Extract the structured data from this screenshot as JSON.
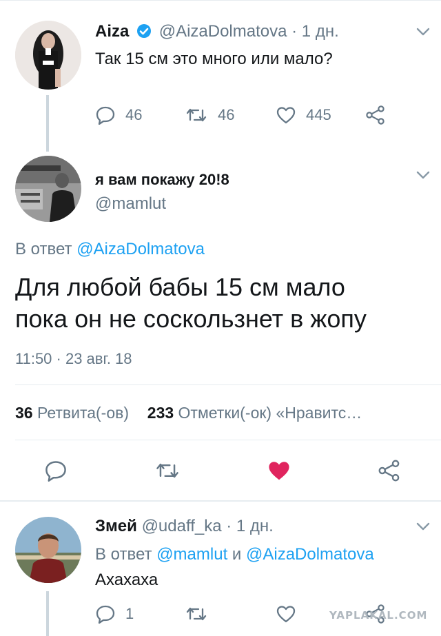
{
  "tweet1": {
    "name": "Aiza",
    "handle": "@AizaDolmatova",
    "time": "· 1 дн.",
    "text": "Так 15 см это много или мало?",
    "reply_count": "46",
    "retweet_count": "46",
    "like_count": "445"
  },
  "tweet2": {
    "name": "я вам покажу 20!8",
    "handle": "@mamlut",
    "reply_prefix": "В ответ",
    "reply_to": "@AizaDolmatova",
    "text_line1": "Для любой бабы 15 см мало",
    "text_line2": "пока он не соскользнет в жопу",
    "timestamp": "11:50 · 23 авг. 18",
    "retweets_num": "36",
    "retweets_label": "Ретвита(-ов)",
    "likes_num": "233",
    "likes_label": "Отметки(-ок) «Нравитс…"
  },
  "tweet3": {
    "name": "Змей",
    "handle": "@udaff_ka",
    "time": "· 1 дн.",
    "reply_prefix": "В ответ",
    "reply_to_1": "@mamlut",
    "reply_and": "и",
    "reply_to_2": "@AizaDolmatova",
    "text": "Ахахаха",
    "reply_count": "1"
  },
  "colors": {
    "accent": "#1da1f2",
    "like_active": "#e0245e",
    "muted": "#657786",
    "verified": "#1da1f2"
  },
  "icons": [
    "chevron-down-icon",
    "verified-icon",
    "reply-icon",
    "retweet-icon",
    "like-icon",
    "share-icon"
  ],
  "watermark": "YAPLAKAL.COM"
}
